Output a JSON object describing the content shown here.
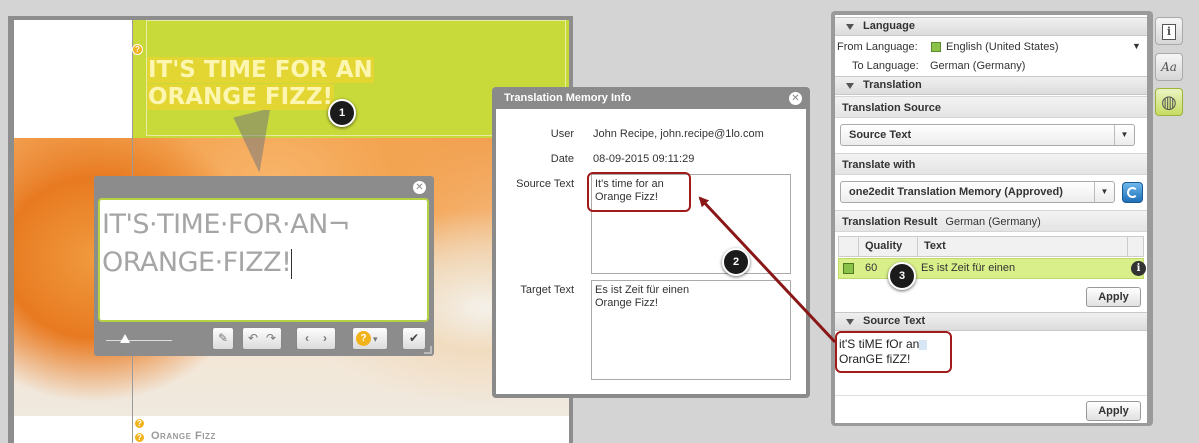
{
  "document": {
    "headline_line1": "IT'S TIME FOR AN",
    "headline_line2": "ORANGE FIZZ!",
    "bottom_caption": "Orange Fizz",
    "badge_glyph": "?"
  },
  "editor": {
    "line1": "IT'S·TIME·FOR·AN¬",
    "line2": "ORANGE·FIZZ!",
    "close_glyph": "✕",
    "tools": {
      "eyedropper": "✎",
      "undo": "↶",
      "redo": "↷",
      "prev": "‹",
      "next": "›",
      "help": "?",
      "help_caret": "▾",
      "confirm": "✔"
    }
  },
  "tm_dialog": {
    "title": "Translation Memory Info",
    "close_glyph": "✕",
    "user_label": "User",
    "user_value": "John Recipe, john.recipe@1lo.com",
    "date_label": "Date",
    "date_value": "08-09-2015 09:11:29",
    "source_label": "Source Text",
    "source_line1": "It's time for an",
    "source_line2": "Orange Fizz!",
    "target_label": "Target Text",
    "target_line1": "Es ist Zeit für einen",
    "target_line2": "Orange Fizz!"
  },
  "panel": {
    "language_header": "Language",
    "from_label": "From Language:",
    "from_value": "English (United States)",
    "to_label": "To Language:",
    "to_value": "German (Germany)",
    "translation_header": "Translation",
    "translation_source_label": "Translation Source",
    "translation_source_value": "Source Text",
    "translate_with_label": "Translate with",
    "translate_with_value": "one2edit Translation Memory (Approved)",
    "result_label": "Translation Result",
    "result_lang": "German (Germany)",
    "col_quality": "Quality",
    "col_text": "Text",
    "row_quality": "60",
    "row_text": "Es ist Zeit für einen",
    "apply_label": "Apply",
    "source_text_header": "Source Text",
    "source_text_line1": "it'S tiME fOr an",
    "source_text_line2": "OranGE fiZZ!",
    "apply2_label": "Apply",
    "caret_glyph": "▼"
  },
  "side_buttons": {
    "info_glyph": "i",
    "font_glyph": "Aa",
    "globe_glyph": "◍"
  },
  "markers": {
    "m1": "1",
    "m2": "2",
    "m3": "3"
  },
  "colors": {
    "brand_green": "#c8da3a",
    "highlight_red": "#a01c1c",
    "result_row_green": "#d9f08a"
  }
}
